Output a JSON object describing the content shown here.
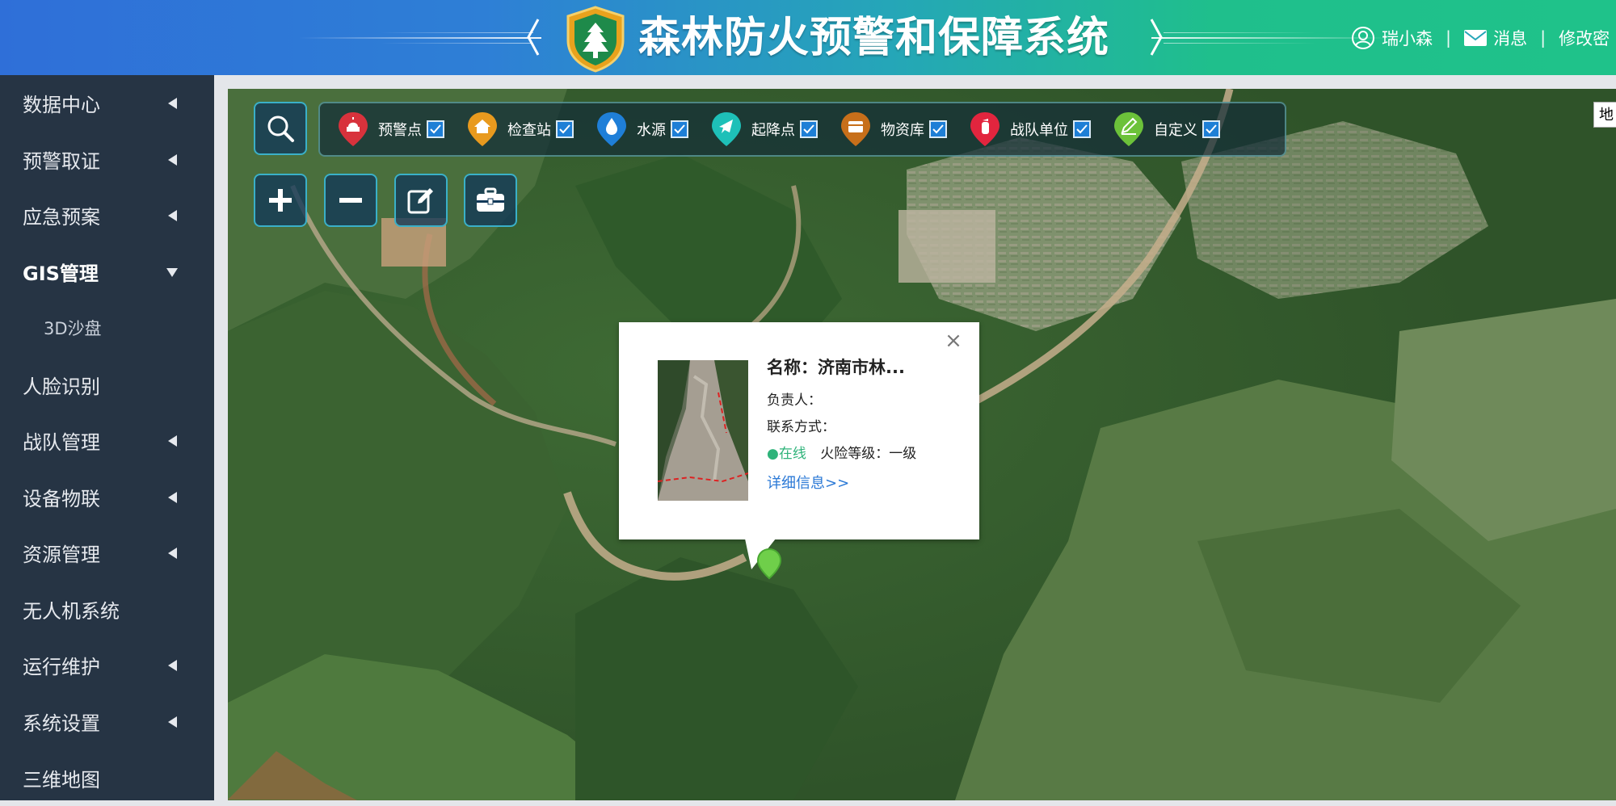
{
  "header": {
    "title": "森林防火预警和保障系统",
    "user_name": "瑞小森",
    "messages_label": "消息",
    "change_password_label": "修改密"
  },
  "sidebar": {
    "items": [
      {
        "label": "数据中心",
        "arrow": "left"
      },
      {
        "label": "预警取证",
        "arrow": "left"
      },
      {
        "label": "应急预案",
        "arrow": "left"
      },
      {
        "label": "GIS管理",
        "arrow": "down",
        "active": true
      },
      {
        "label": "3D沙盘",
        "sub": true
      },
      {
        "label": "人脸识别"
      },
      {
        "label": "战队管理",
        "arrow": "left"
      },
      {
        "label": "设备物联",
        "arrow": "left"
      },
      {
        "label": "资源管理",
        "arrow": "left"
      },
      {
        "label": "无人机系统"
      },
      {
        "label": "运行维护",
        "arrow": "left"
      },
      {
        "label": "系统设置",
        "arrow": "left"
      },
      {
        "label": "三维地图"
      }
    ]
  },
  "map": {
    "layers": [
      {
        "label": "预警点",
        "color": "#d8323c",
        "icon": "alarm-light-icon",
        "checked": true
      },
      {
        "label": "检查站",
        "color": "#e89a1e",
        "icon": "house-icon",
        "checked": true
      },
      {
        "label": "水源",
        "color": "#1f7fd8",
        "icon": "water-drop-icon",
        "checked": true
      },
      {
        "label": "起降点",
        "color": "#1ec0b8",
        "icon": "airplane-icon",
        "checked": true
      },
      {
        "label": "物资库",
        "color": "#c76f1a",
        "icon": "supply-box-icon",
        "checked": true
      },
      {
        "label": "战队单位",
        "color": "#e2253e",
        "icon": "fire-extinguisher-icon",
        "checked": true
      },
      {
        "label": "自定义",
        "color": "#6cc23a",
        "icon": "pencil-icon",
        "checked": true
      }
    ],
    "map_type_label": "地",
    "popup": {
      "name": "名称：济南市林...",
      "owner_label": "负责人：",
      "contact_label": "联系方式：",
      "status": "●在线",
      "fire_level": "火险等级：一级",
      "detail_link": "详细信息>>"
    }
  },
  "colors": {
    "sidebar_bg": "#263444",
    "header_start": "#2f6fd8",
    "header_end": "#1fc28a",
    "online": "#2fb37a",
    "link": "#2b79d6"
  }
}
